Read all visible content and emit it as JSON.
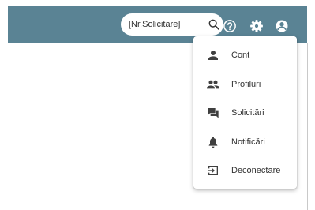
{
  "header": {
    "search": {
      "placeholder": "[Nr.Solicitare]",
      "value": ""
    },
    "icons": [
      "search-icon",
      "help-icon",
      "settings-icon",
      "account-icon"
    ]
  },
  "user_menu": {
    "items": [
      {
        "label": "Cont",
        "icon": "person-icon"
      },
      {
        "label": "Profiluri",
        "icon": "people-icon"
      },
      {
        "label": "Solicitări",
        "icon": "forum-icon"
      },
      {
        "label": "Notificări",
        "icon": "bell-icon"
      },
      {
        "label": "Deconectare",
        "icon": "logout-icon"
      }
    ]
  },
  "colors": {
    "header_bg": "#5a8394",
    "icon_white": "#ffffff",
    "menu_text": "#333333",
    "menu_icon": "#3f3f3f"
  }
}
